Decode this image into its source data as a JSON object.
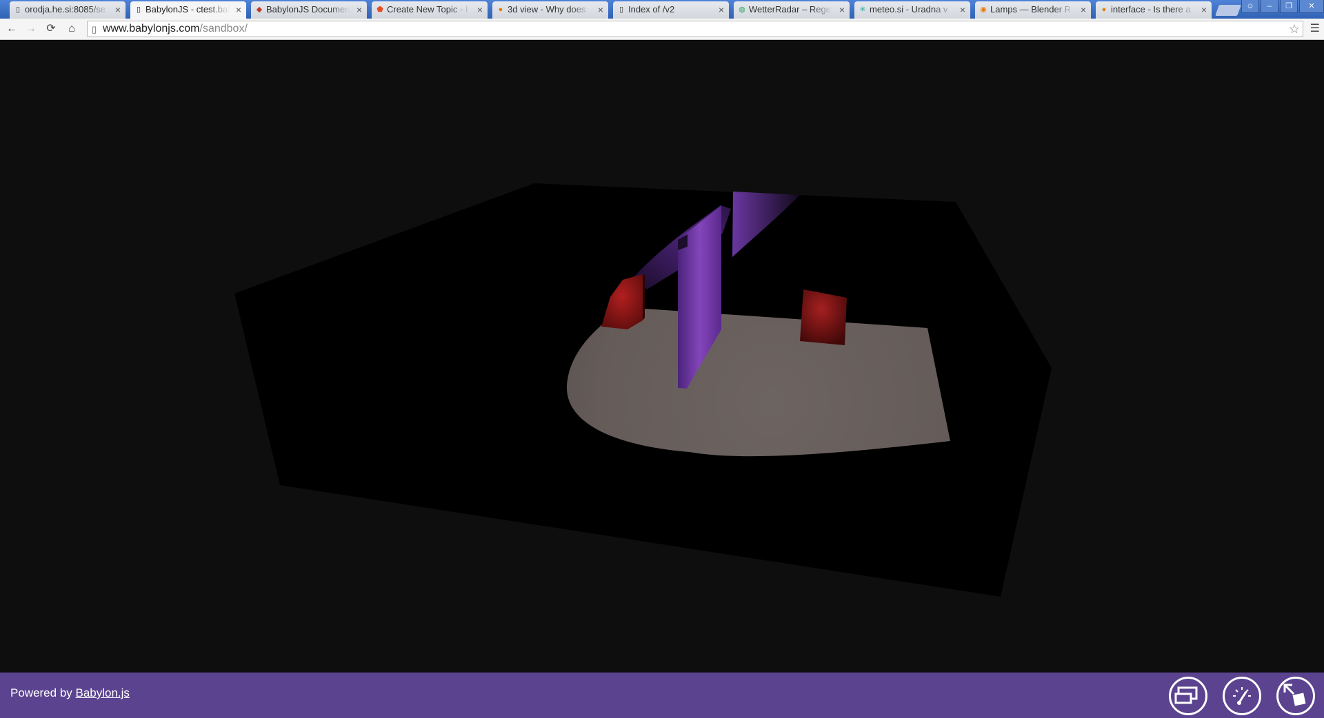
{
  "browser": {
    "tabs": [
      {
        "title": "orodja.he.si:8085/se",
        "favicon": "page-icon",
        "active": false
      },
      {
        "title": "BabylonJS - ctest.bal",
        "favicon": "page-icon",
        "active": true
      },
      {
        "title": "BabylonJS Documen",
        "favicon": "babylon-icon",
        "active": false
      },
      {
        "title": "Create New Topic - I",
        "favicon": "html5-icon",
        "active": false
      },
      {
        "title": "3d view - Why does",
        "favicon": "blender-se-icon",
        "active": false
      },
      {
        "title": "Index of /v2",
        "favicon": "page-icon",
        "active": false
      },
      {
        "title": "WetterRadar – Rege",
        "favicon": "globe-icon",
        "active": false
      },
      {
        "title": "meteo.si - Uradna v",
        "favicon": "meteo-icon",
        "active": false
      },
      {
        "title": "Lamps — Blender R",
        "favicon": "blender-icon",
        "active": false
      },
      {
        "title": "interface - Is there a",
        "favicon": "blender-se-icon",
        "active": false
      }
    ],
    "close_glyph": "×",
    "url_host": "www.babylonjs.com",
    "url_path": "/sandbox/"
  },
  "footer": {
    "powered_prefix": "Powered by ",
    "powered_link": "Babylon.js",
    "buttons": [
      "debug-layer-icon",
      "fps-meter-icon",
      "fullscreen-icon"
    ]
  },
  "colors": {
    "tab_strip": "#3b6fc4",
    "viewport_bg": "#0e0e0e",
    "footer_bg": "#5b438f",
    "floor_lit": "#6a615f",
    "purple_wall": "#7d3fb0",
    "red_box": "#a81d1d"
  }
}
